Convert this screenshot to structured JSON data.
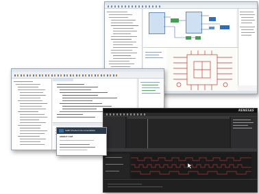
{
  "collage": {
    "screens": [
      {
        "name": "model-diagram-editor",
        "theme": "light"
      },
      {
        "name": "code-editor-ide",
        "theme": "light"
      },
      {
        "name": "dark-signal-analyzer",
        "theme": "dark"
      }
    ]
  },
  "code_ide": {
    "doc_header": "SABT Product Documentation",
    "doc_title": "ABOUT CVE"
  },
  "dark_tool": {
    "brand": "RENESAS"
  },
  "colors": {
    "accent_blue": "#2f6db5",
    "diagram_green": "#3fa34d",
    "schematic_red": "#c0392b",
    "signal_red": "#b23a3a",
    "dark_bg": "#1e1e1e"
  }
}
